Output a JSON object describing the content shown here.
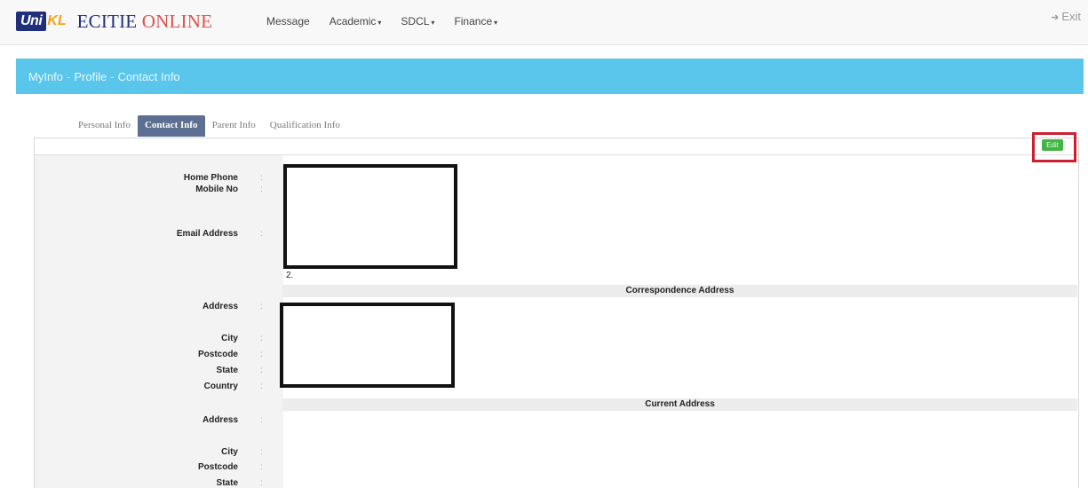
{
  "brand": {
    "logo_uni": "Uni",
    "logo_kl": "KL",
    "title_part1": "ECITIE",
    "title_part2": "ONLINE"
  },
  "nav": {
    "message": "Message",
    "academic": "Academic",
    "sdcl": "SDCL",
    "finance": "Finance",
    "caret": "▾",
    "exit": "Exit",
    "exit_icon": "➜"
  },
  "breadcrumb": {
    "myinfo": "MyInfo",
    "profile": "Profile",
    "contact_info": "Contact Info",
    "sep": "-"
  },
  "tabs": {
    "personal": "Personal Info",
    "contact": "Contact Info",
    "parent": "Parent Info",
    "qualification": "Qualification Info"
  },
  "edit_label": "Edit",
  "colon": ":",
  "contact": {
    "home_phone": "Home Phone",
    "mobile_no": "Mobile No",
    "email_address": "Email Address",
    "marker": "2."
  },
  "correspondence": {
    "header": "Correspondence Address",
    "address": "Address",
    "city": "City",
    "postcode": "Postcode",
    "state": "State",
    "country": "Country"
  },
  "current": {
    "header": "Current Address",
    "address": "Address",
    "city": "City",
    "postcode": "Postcode",
    "state": "State"
  },
  "colors": {
    "breadcrumb_bg": "#5bc6ec",
    "active_tab": "#5d6f92",
    "edit_btn": "#42b542",
    "highlight": "#cc1f2f"
  }
}
